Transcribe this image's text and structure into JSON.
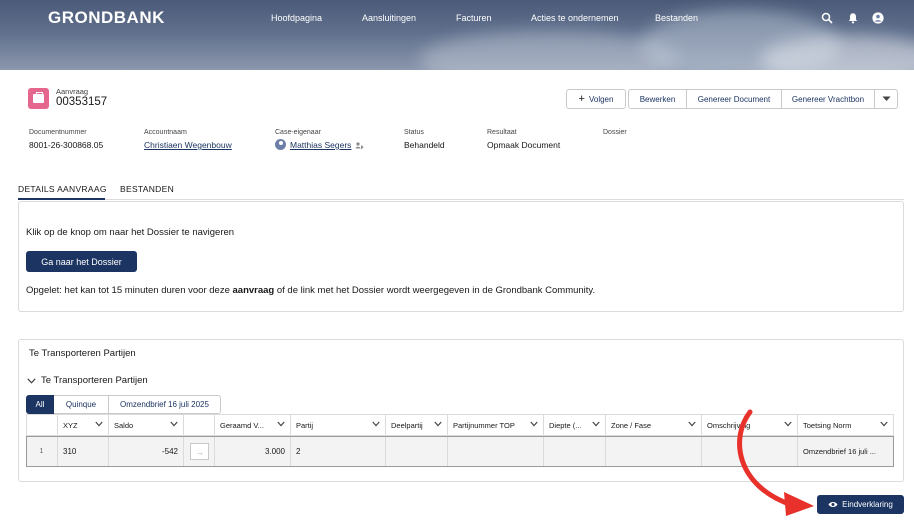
{
  "header": {
    "brand": "GRONDBANK",
    "nav": [
      "Hoofdpagina",
      "Aansluitingen",
      "Facturen",
      "Acties te ondernemen",
      "Bestanden"
    ]
  },
  "record": {
    "type": "Aanvraag",
    "number": "00353157",
    "actions": {
      "follow": "Volgen",
      "edit": "Bewerken",
      "gen_document": "Genereer Document",
      "gen_vrachtbon": "Genereer Vrachtbon"
    }
  },
  "fields": [
    {
      "label": "Documentnummer",
      "value": "8001-26-300868.05"
    },
    {
      "label": "Accountnaam",
      "value": "Christiaen Wegenbouw"
    },
    {
      "label": "Case-eigenaar",
      "value": "Matthias Segers"
    },
    {
      "label": "Status",
      "value": "Behandeld"
    },
    {
      "label": "Resultaat",
      "value": "Opmaak Document"
    },
    {
      "label": "Dossier",
      "value": ""
    }
  ],
  "tabs": [
    "DETAILS AANVRAAG",
    "BESTANDEN"
  ],
  "info": {
    "line1": "Klik op de knop om naar het Dossier te navigeren",
    "button": "Ga naar het Dossier",
    "warning_prefix": "Opgelet: het kan tot 15 minuten duren voor deze ",
    "warning_bold": "aanvraag",
    "warning_suffix": " of de link met het Dossier wordt weergegeven in de Grondbank Community."
  },
  "section": {
    "title": "Te Transporteren Partijen",
    "subtitle": "Te Transporteren Partijen",
    "filters": [
      "All",
      "Quinque",
      "Omzendbrief 16 juli 2025"
    ],
    "columns": [
      "XYZ",
      "Saldo",
      "",
      "Geraamd V...",
      "Partij",
      "Deelpartij",
      "Partijnummer TOP",
      "Diepte (...",
      "Zone / Fase",
      "Omschrijving",
      "Toetsing Norm"
    ],
    "rows": [
      {
        "index": "1",
        "xyz": "310",
        "saldo": "-542",
        "geraamd": "3.000",
        "partij": "2",
        "deelpartij": "",
        "partijnummer": "",
        "diepte": "",
        "zone": "",
        "omschrijving": "",
        "toetsing": "Omzendbrief 16 juli ..."
      }
    ]
  },
  "footer": {
    "button": "Eindverklaring"
  },
  "colors": {
    "accent": "#1b3461",
    "record_icon": "#e6678d",
    "arrow": "#e8312a"
  }
}
